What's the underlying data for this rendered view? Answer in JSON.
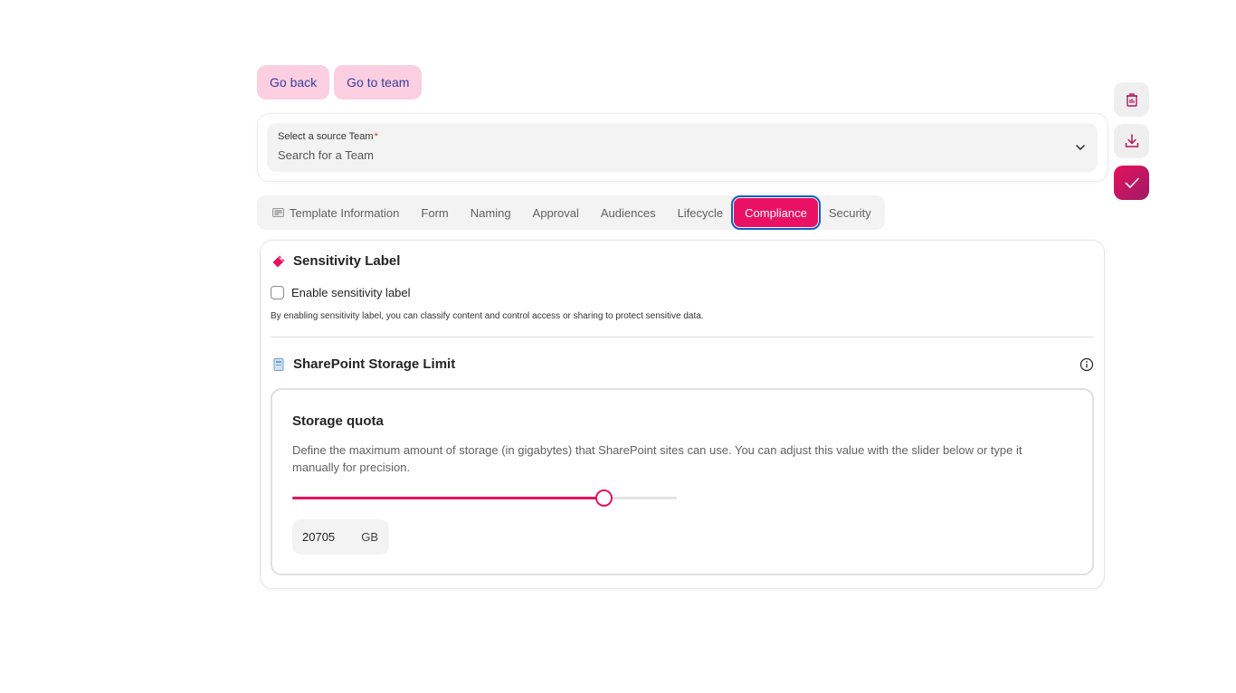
{
  "header": {
    "go_back_label": "Go back",
    "go_to_team_label": "Go to team"
  },
  "source_team": {
    "label": "Select a source Team",
    "required_mark": "*",
    "placeholder": "Search for a Team"
  },
  "side_actions": [
    {
      "icon": "delete-icon",
      "name": "delete-button"
    },
    {
      "icon": "download-icon",
      "name": "download-button"
    },
    {
      "icon": "checkmark-icon",
      "name": "save-button"
    }
  ],
  "tabs": [
    {
      "label": "Template Information",
      "icon": "template-info-icon"
    },
    {
      "label": "Form"
    },
    {
      "label": "Naming"
    },
    {
      "label": "Approval"
    },
    {
      "label": "Audiences"
    },
    {
      "label": "Lifecycle"
    },
    {
      "label": "Compliance",
      "active": true
    },
    {
      "label": "Security"
    }
  ],
  "sensitivity": {
    "title": "Sensitivity Label",
    "checkbox_label": "Enable sensitivity label",
    "checked": false,
    "hint": "By enabling sensitivity label, you can classify content and control access or sharing to protect sensitive data."
  },
  "storage": {
    "title": "SharePoint Storage Limit",
    "quota_title": "Storage quota",
    "quota_description": "Define the maximum amount of storage (in gigabytes) that SharePoint sites can use. You can adjust this value with the slider below or type it manually for precision.",
    "slider_fraction": 0.81,
    "value": "20705",
    "unit": "GB"
  },
  "colors": {
    "accent": "#e8115e",
    "button_bg": "#fbcfe0",
    "button_text": "#3a3d9e",
    "focus_outline": "#0f5fc4"
  }
}
